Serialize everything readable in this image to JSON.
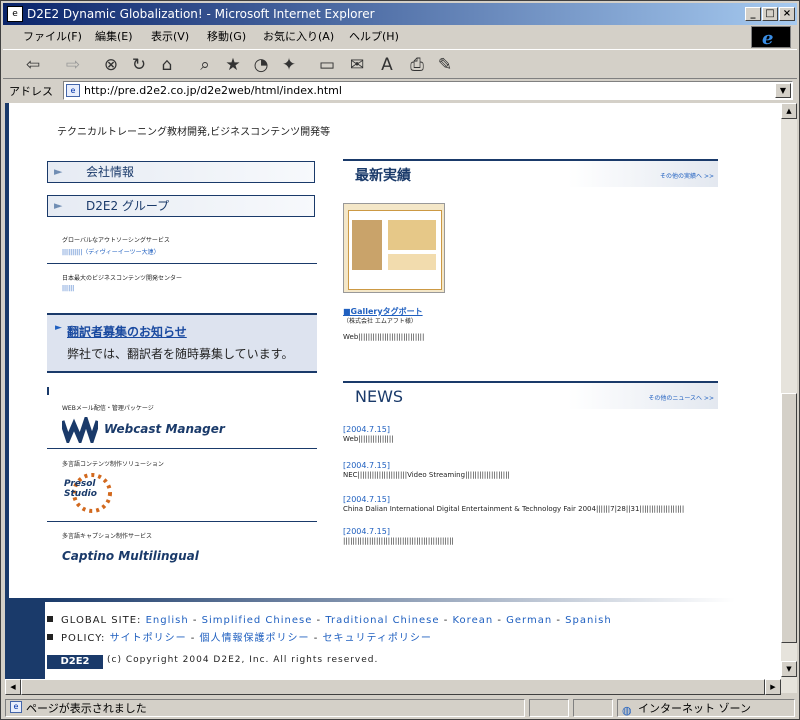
{
  "window": {
    "title": "D2E2 Dynamic Globalization! - Microsoft Internet Explorer",
    "title_icon": "page-icon",
    "minimize": "_",
    "maximize": "□",
    "close": "×"
  },
  "menubar": {
    "items": [
      "ファイル(F)",
      "編集(E)",
      "表示(V)",
      "移動(G)",
      "お気に入り(A)",
      "ヘルプ(H)"
    ]
  },
  "toolbar": {
    "buttons": [
      "back-icon",
      "forward-icon",
      "stop-icon",
      "refresh-icon",
      "home-icon",
      "search-icon",
      "favorites-icon",
      "history-icon",
      "channels-icon",
      "fullscreen-icon",
      "mail-icon",
      "font-icon",
      "print-icon",
      "edit-icon"
    ]
  },
  "address": {
    "label": "アドレス",
    "url": "http://pre.d2e2.co.jp/d2e2web/html/index.html"
  },
  "page": {
    "tagline": "テクニカルトレーニング教材開発,ビジネスコンテンツ開発等",
    "nav": {
      "company": "会社情報",
      "group": "D2E2 グループ"
    },
    "left_items": [
      {
        "caption": "グローバルなアウトソーシングサービス",
        "link": "||||||||||（ディヴィーイーツー大連）"
      },
      {
        "caption": "日本最大のビジネスコンテンツ開発センター",
        "link": "||||||"
      }
    ],
    "recruit": {
      "title": "翻訳者募集のお知らせ",
      "text": "弊社では、翻訳者を随時募集しています。"
    },
    "products": [
      {
        "caption": "WEBメール配信・管理パッケージ",
        "name": "Webcast Manager"
      },
      {
        "caption": "多言語コンテンツ制作ソリューション",
        "name": "Presol Studio"
      },
      {
        "caption": "多言語キャプション制作サービス",
        "name": "Captino Multilingual"
      }
    ],
    "latest": {
      "heading": "最新実績",
      "more": "その他の実績へ >>",
      "gallery_link": "■Galleryタグボート",
      "gallery_sub": "（株式会社 エムアフト様）",
      "gallery_desc": "Web||||||||||||||||||||||||||||"
    },
    "news": {
      "heading": "NEWS",
      "more": "その他のニュースへ >>",
      "items": [
        {
          "date": "[2004.7.15]",
          "text": "Web|||||||||||||||"
        },
        {
          "date": "[2004.7.15]",
          "text": "NEC|||||||||||||||||||||Video Streaming|||||||||||||||||||"
        },
        {
          "date": "[2004.7.15]",
          "text": "China Dalian International Digital Entertainment & Technology Fair 2004||||||7|28||31|||||||||||||||||||"
        },
        {
          "date": "[2004.7.15]",
          "text": "|||||||||||||||||||||||||||||||||||||||||||||||"
        }
      ]
    },
    "footer": {
      "global_label": "GLOBAL SITE:",
      "global_links": [
        "English",
        "Simplified Chinese",
        "Traditional Chinese",
        "Korean",
        "German",
        "Spanish"
      ],
      "policy_label": "POLICY:",
      "policy_links": [
        "サイトポリシー",
        "個人情報保護ポリシー",
        "セキュリティポリシー"
      ],
      "logo": "D2E2",
      "copyright": "(c) Copyright 2004 D2E2, Inc. All rights reserved."
    }
  },
  "status": {
    "text": "ページが表示されました",
    "zone": "インターネット ゾーン"
  },
  "colors": {
    "title_start": "#0a246a",
    "title_end": "#a6caf0",
    "brand_navy": "#1a3a6a",
    "link_blue": "#2060c0"
  }
}
